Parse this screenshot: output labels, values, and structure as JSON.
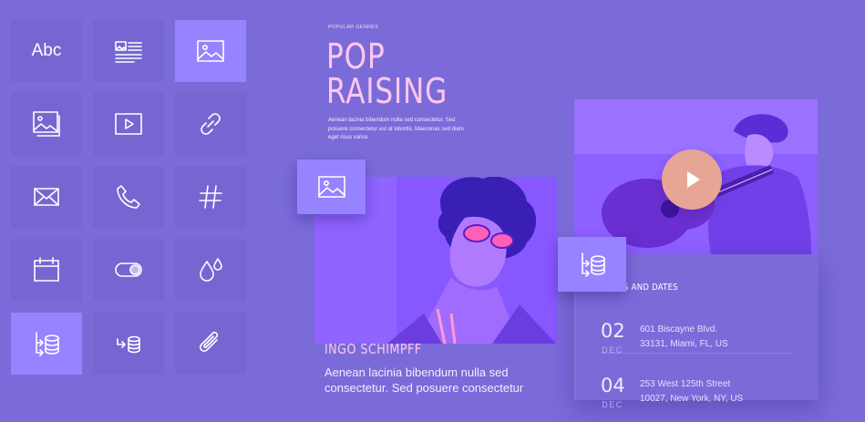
{
  "palette": {
    "tiles": [
      {
        "name": "text-tile",
        "icon": "abc-text-icon",
        "label": "Abc",
        "active": false
      },
      {
        "name": "text-image-tile",
        "icon": "text-with-image-icon",
        "active": false
      },
      {
        "name": "image-tile",
        "icon": "image-icon",
        "active": true
      },
      {
        "name": "gallery-tile",
        "icon": "gallery-icon",
        "active": false
      },
      {
        "name": "video-tile",
        "icon": "video-play-icon",
        "active": false
      },
      {
        "name": "link-tile",
        "icon": "link-icon",
        "active": false
      },
      {
        "name": "email-tile",
        "icon": "envelope-icon",
        "active": false
      },
      {
        "name": "phone-tile",
        "icon": "phone-icon",
        "active": false
      },
      {
        "name": "hashtag-tile",
        "icon": "hashtag-icon",
        "active": false
      },
      {
        "name": "calendar-tile",
        "icon": "calendar-icon",
        "active": false
      },
      {
        "name": "toggle-tile",
        "icon": "toggle-icon",
        "active": false
      },
      {
        "name": "drops-tile",
        "icon": "water-drops-icon",
        "active": false
      },
      {
        "name": "data-source-tile",
        "icon": "data-source-icon",
        "active": true
      },
      {
        "name": "data-merge-tile",
        "icon": "data-merge-icon",
        "active": false
      },
      {
        "name": "attachment-tile",
        "icon": "paperclip-icon",
        "active": false
      }
    ]
  },
  "hero": {
    "kicker": "POPULAR GENRES",
    "title_line1": "POP",
    "title_line2": "RAISING",
    "intro": "Aenean lacinia bibendum nulla sed consectetur. Sed posuere consectetur est at lobortis. Maecenas sed diam eget risus varius"
  },
  "artist": {
    "name": "INGO SCHIMPFF",
    "bio": "Aenean lacinia bibendum nulla sed consectetur. Sed posuere consectetur"
  },
  "tour": {
    "heading": "TOURS AND DATES",
    "dates": [
      {
        "day": "02",
        "month": "DEC",
        "address_line1": "601 Biscayne Blvd.",
        "address_line2": "33131, Miami, FL, US"
      },
      {
        "day": "04",
        "month": "DEC",
        "address_line1": "253 West 125th Street",
        "address_line2": "10027, New York, NY, US"
      }
    ]
  },
  "colors": {
    "background": "#7a6bd9",
    "tile": "#7566d2",
    "tile_active": "#9683ff",
    "title_pink": "#ffc7ee",
    "play_button": "#e7a695"
  }
}
